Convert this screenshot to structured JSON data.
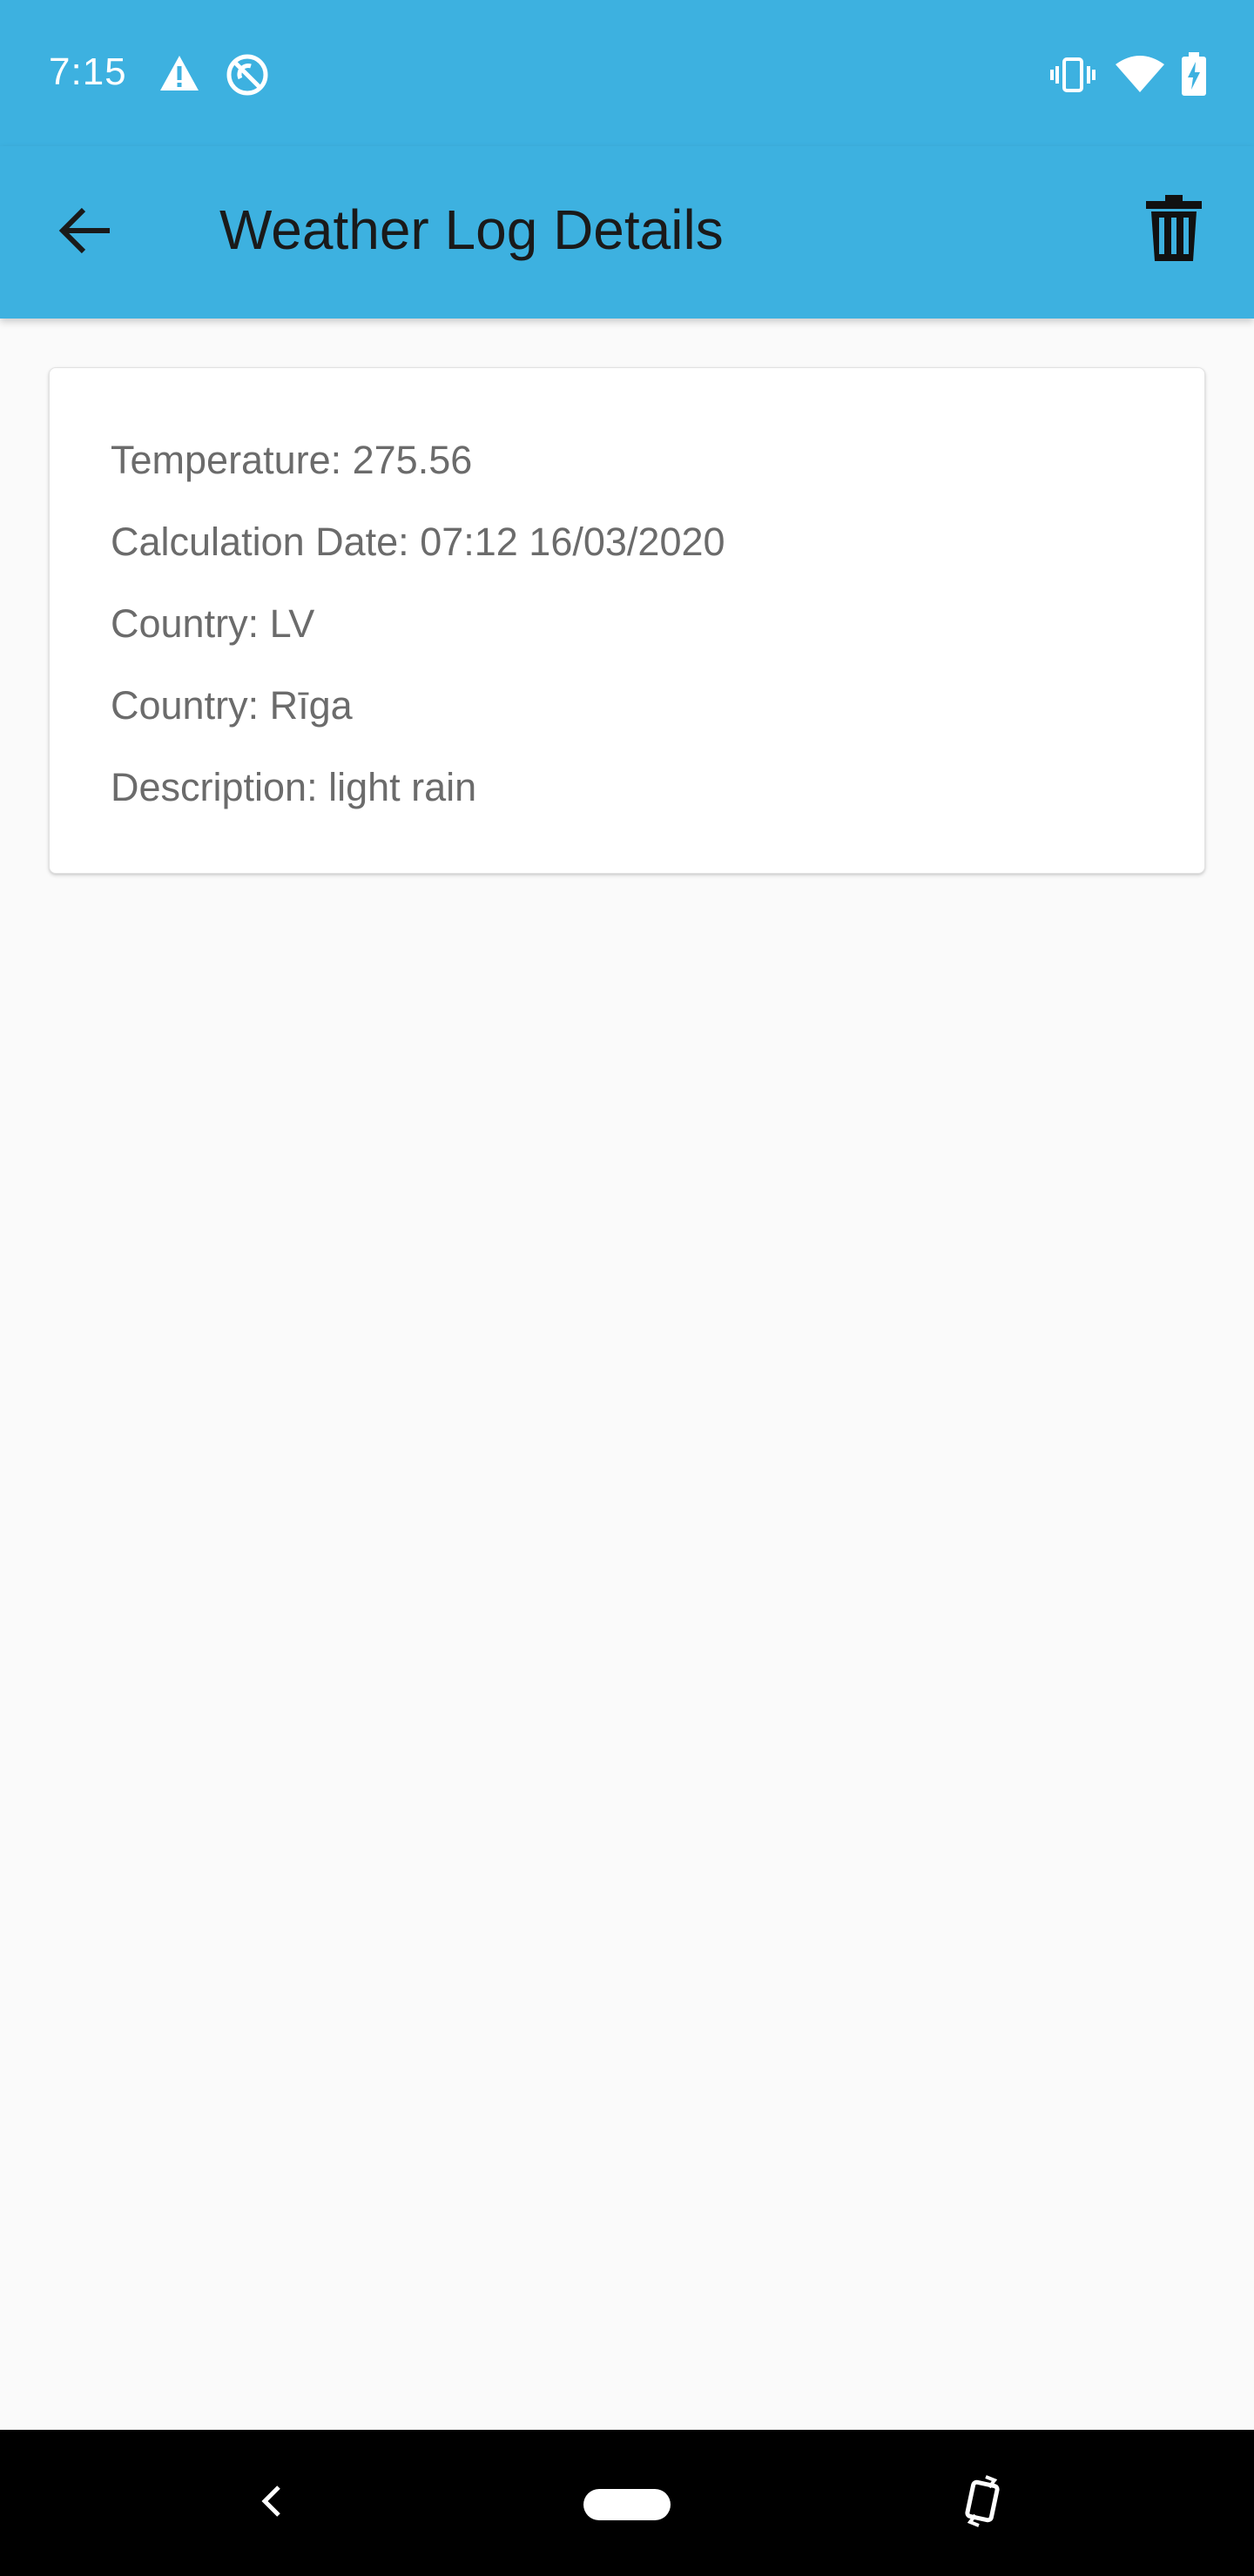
{
  "status_bar": {
    "time": "7:15",
    "icons_left": [
      "warning-icon",
      "blocked-sync-icon"
    ],
    "icons_right": [
      "vibrate-icon",
      "wifi-icon",
      "battery-charging-icon"
    ]
  },
  "app_bar": {
    "title": "Weather Log Details",
    "back_icon": "arrow-back-icon",
    "delete_icon": "trash-icon"
  },
  "details": {
    "temperature": "Temperature: 275.56",
    "calculation_date": "Calculation Date: 07:12 16/03/2020",
    "country": "Country: LV",
    "city": "Country: Rīga",
    "description": "Description: light rain"
  },
  "nav_bar": {
    "back_icon": "nav-back-icon",
    "home_icon": "home-pill-icon",
    "rotate_icon": "rotate-icon"
  },
  "colors": {
    "accent": "#3db1e0",
    "background": "#fafafa",
    "card": "#ffffff",
    "text_secondary": "#6b6b6b"
  }
}
